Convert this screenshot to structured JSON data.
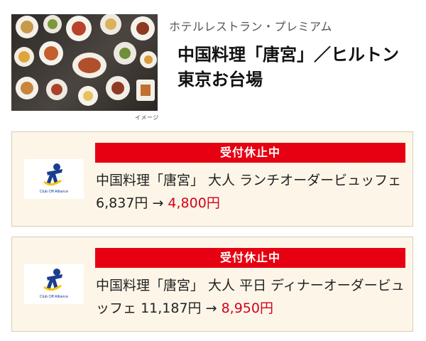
{
  "header": {
    "category": "ホテルレストラン・プレミアム",
    "title": "中国料理「唐宮」／ヒルトン東京お台場",
    "image_caption": "イメージ"
  },
  "offers": [
    {
      "status": "受付休止中",
      "logo_text": "Club Off Alliance",
      "description": "中国料理「唐宮」 大人 ランチオーダービュッフェ",
      "regular_price": "6,837円",
      "arrow": "→",
      "sale_price": "4,800円"
    },
    {
      "status": "受付休止中",
      "logo_text": "Club Off Alliance",
      "description": "中国料理「唐宮」 大人 平日 ディナーオーダービュッフェ",
      "regular_price": "11,187円",
      "arrow": "→",
      "sale_price": "8,950円"
    }
  ],
  "colors": {
    "status_red": "#e60012",
    "sale_red": "#d4001b",
    "card_bg": "#fdf6e8",
    "logo_blue": "#1a3f8f",
    "logo_yellow": "#f5c400"
  }
}
